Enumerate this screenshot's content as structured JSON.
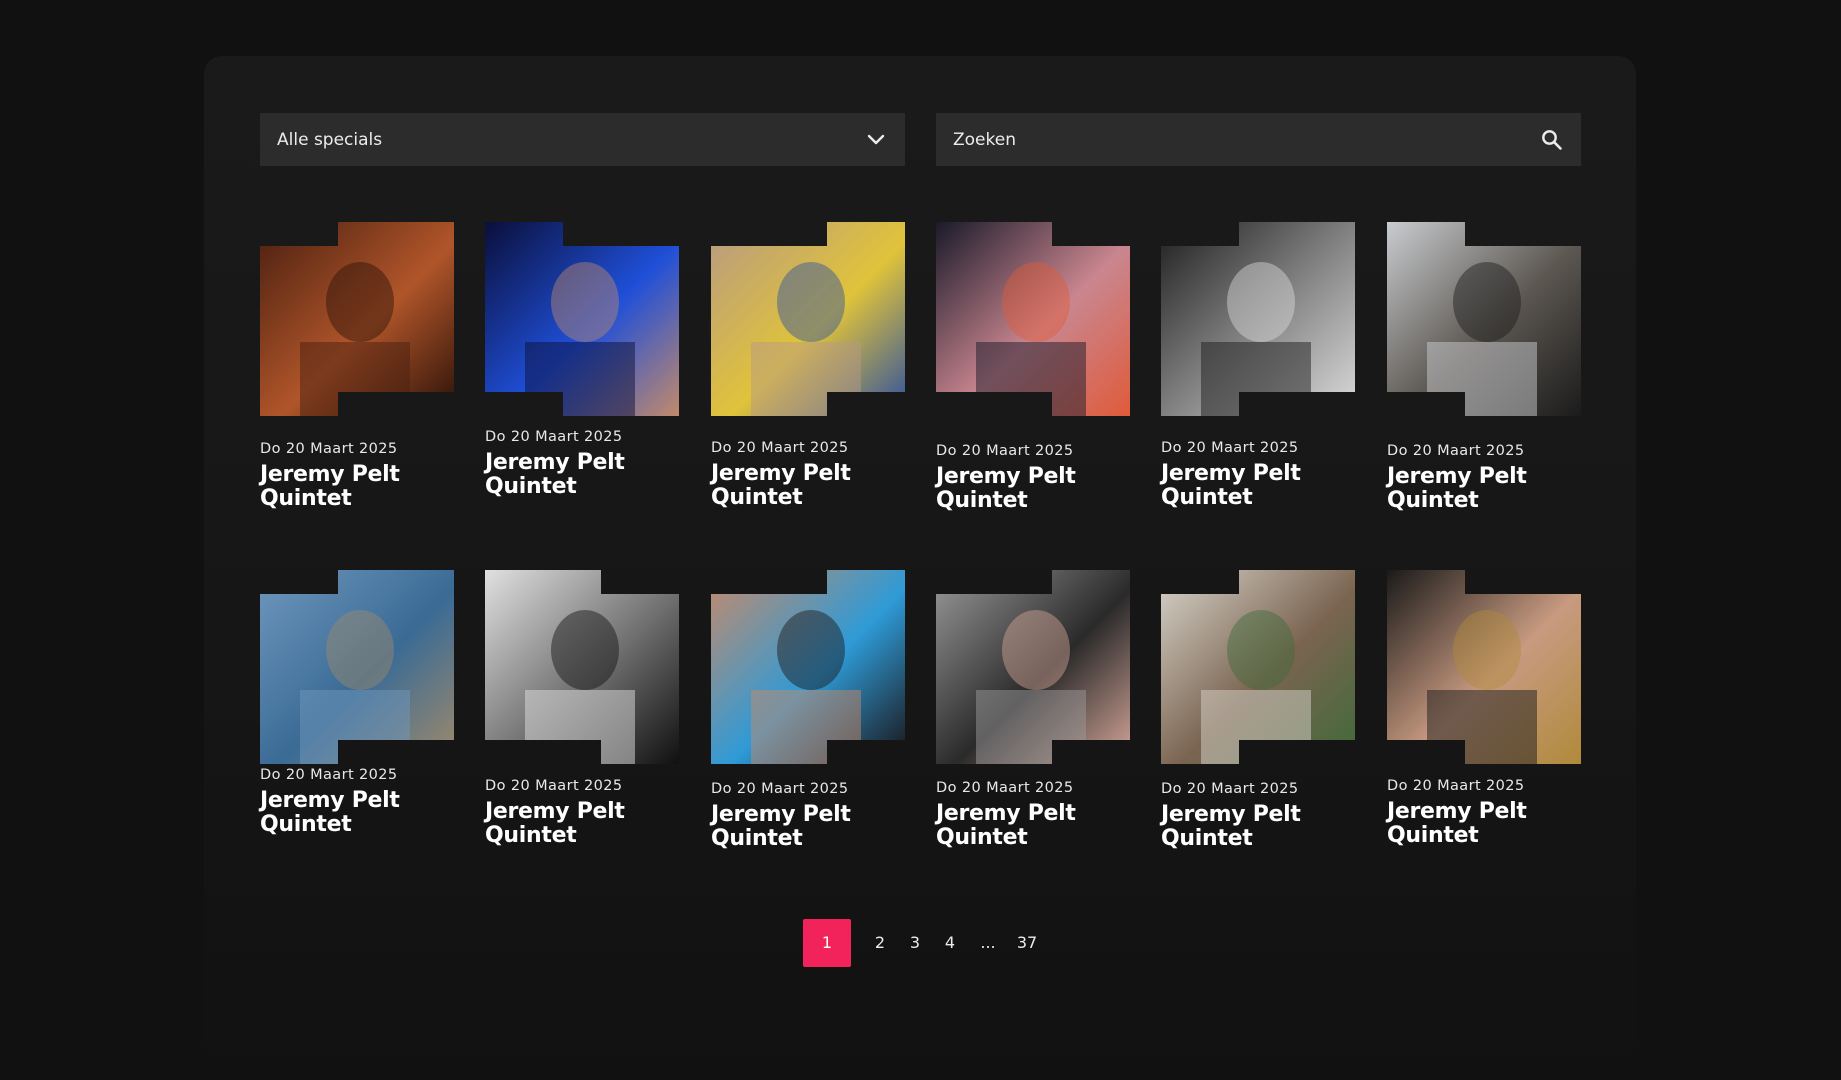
{
  "filters": {
    "select_label": "Alle specials",
    "search_placeholder": "Zoeken"
  },
  "events": [
    {
      "date": "Do 20 Maart 2025",
      "title": "Jeremy Pelt Quintet",
      "image": "trumpet-player-photo",
      "palette": [
        "#4a1f10",
        "#b0552a",
        "#2a1108"
      ]
    },
    {
      "date": "Do 20 Maart 2025",
      "title": "Jeremy Pelt Quintet",
      "image": "singer-blue-light-photo",
      "palette": [
        "#0b0f3a",
        "#1f4fd8",
        "#c28a6b"
      ]
    },
    {
      "date": "Do 20 Maart 2025",
      "title": "Jeremy Pelt Quintet",
      "image": "seated-group-photo",
      "palette": [
        "#b79a83",
        "#e0c33a",
        "#2c4fa0"
      ]
    },
    {
      "date": "Do 20 Maart 2025",
      "title": "Jeremy Pelt Quintet",
      "image": "keyboard-player-photo",
      "palette": [
        "#1a1a2a",
        "#c9868f",
        "#e05a3a"
      ]
    },
    {
      "date": "Do 20 Maart 2025",
      "title": "Jeremy Pelt Quintet",
      "image": "singer-black-white-photo",
      "palette": [
        "#1e1e1e",
        "#8a8a8a",
        "#dcdcdc"
      ]
    },
    {
      "date": "Do 20 Maart 2025",
      "title": "Jeremy Pelt Quintet",
      "image": "man-with-scarf-photo",
      "palette": [
        "#c9ccd0",
        "#5b5650",
        "#1b1b1b"
      ]
    },
    {
      "date": "Do 20 Maart 2025",
      "title": "Jeremy Pelt Quintet",
      "image": "beach-stage-photo",
      "palette": [
        "#6f97bd",
        "#3a6b95",
        "#a08a6a"
      ]
    },
    {
      "date": "Do 20 Maart 2025",
      "title": "Jeremy Pelt Quintet",
      "image": "woman-sunglasses-photo",
      "palette": [
        "#e0e0e0",
        "#707070",
        "#101010"
      ]
    },
    {
      "date": "Do 20 Maart 2025",
      "title": "Jeremy Pelt Quintet",
      "image": "blue-eyeshadow-portrait-photo",
      "palette": [
        "#c78a6a",
        "#2e9ad6",
        "#1a1111"
      ]
    },
    {
      "date": "Do 20 Maart 2025",
      "title": "Jeremy Pelt Quintet",
      "image": "band-group-photo",
      "palette": [
        "#9a9a9a",
        "#2a2a2a",
        "#d8a89a"
      ]
    },
    {
      "date": "Do 20 Maart 2025",
      "title": "Jeremy Pelt Quintet",
      "image": "flute-player-photo",
      "palette": [
        "#d8d4cc",
        "#7a6450",
        "#3f6a3a"
      ]
    },
    {
      "date": "Do 20 Maart 2025",
      "title": "Jeremy Pelt Quintet",
      "image": "saxophonist-portrait-photo",
      "palette": [
        "#1a1a1a",
        "#c89a80",
        "#b08a3a"
      ]
    }
  ],
  "pagination": {
    "pages": [
      "1",
      "2",
      "3",
      "4",
      "...",
      "37"
    ],
    "current": "1"
  },
  "colors": {
    "accent": "#f2235a",
    "background": "#111111",
    "panel": "#1a1a1a",
    "field": "#2c2c2c"
  },
  "icons": {
    "select": "chevron-down-icon",
    "search": "search-icon"
  }
}
